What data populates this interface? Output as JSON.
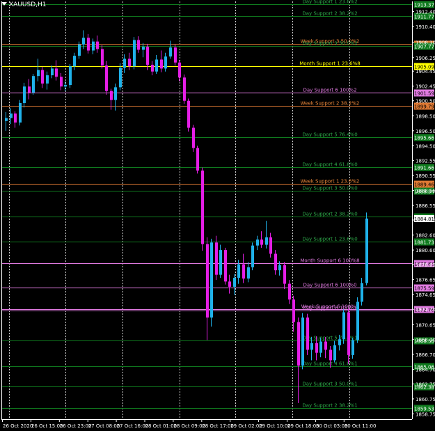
{
  "symbol": "XAUUSD,H1",
  "colors": {
    "background": "#000000",
    "grid": "#ffffff",
    "axis": "#ffffff",
    "text": "#ffffff",
    "bull_candle": "#1fb2ea",
    "bear_candle": "#e51ee6",
    "day_level": "#0f7a1e",
    "day_label": "#2ea84a",
    "week_level": "#e07a34",
    "week_label": "#f08a3a",
    "month_level": "#ffff00",
    "month6_level": "#e07ae0"
  },
  "price_axis": {
    "ticks": [
      "1912.40",
      "1910.40",
      "1908.30",
      "1906.25",
      "1904.45",
      "1902.45",
      "1900.50",
      "1898.50",
      "1896.50",
      "1894.50",
      "1892.55",
      "1890.55",
      "1888.55",
      "1886.55",
      "1884.60",
      "1882.60",
      "1880.60",
      "1878.65",
      "1876.65",
      "1874.65",
      "1872.70",
      "1870.65",
      "1868.70",
      "1866.70",
      "1864.70",
      "1862.75",
      "1860.75",
      "1858.75"
    ]
  },
  "time_axis": {
    "labels": [
      "26 Oct 2020",
      "26 Oct 15:00",
      "26 Oct 23:00",
      "27 Oct 08:00",
      "27 Oct 16:00",
      "28 Oct 01:00",
      "28 Oct 09:00",
      "28 Oct 17:00",
      "29 Oct 02:00",
      "29 Oct 10:00",
      "29 Oct 18:00",
      "30 Oct 03:00",
      "30 Oct 11:00"
    ]
  },
  "levels": [
    {
      "label": "Day Support 1 23.6%2",
      "price_tag": "1913.37",
      "kind": "day",
      "price": 1913.37
    },
    {
      "label": "Day Support 2 38.2%2",
      "price_tag": "1911.77",
      "kind": "day",
      "price": 1911.77
    },
    {
      "label": "Week Support 3 50.0%2",
      "price_tag": "1908.13",
      "kind": "week",
      "price": 1908.13
    },
    {
      "label": "Day Support 3 50.0%2",
      "price_tag": "1907.77",
      "kind": "day",
      "price": 1907.77
    },
    {
      "label": "Month Support 1 23.6%8",
      "price_tag": "1905.09",
      "kind": "month",
      "price": 1905.09
    },
    {
      "label": "Day Support 6 100%2",
      "price_tag": "1901.59",
      "kind": "magenta",
      "price": 1901.59
    },
    {
      "label": "Week Support 2 38.2%2",
      "price_tag": "1899.79",
      "kind": "week",
      "price": 1899.79
    },
    {
      "label": "Day Support 5 76.4%0",
      "price_tag": "1895.66",
      "kind": "day",
      "price": 1895.66
    },
    {
      "label": "Day Support 4 61.8%0",
      "price_tag": "1891.66",
      "kind": "day",
      "price": 1891.66
    },
    {
      "label": "Week Support 1 23.6%2",
      "price_tag": "1889.46",
      "kind": "week",
      "price": 1889.46
    },
    {
      "label": "Day Support 3 50.0%0",
      "price_tag": "1888.54",
      "kind": "day",
      "price": 1888.54
    },
    {
      "label": "Day Support 2 38.2%0",
      "price_tag": "1885.11",
      "kind": "day",
      "price": 1885.11
    },
    {
      "label": "Day Support 1 23.6%0",
      "price_tag": "1881.73",
      "kind": "day",
      "price": 1881.73
    },
    {
      "label": "Month Support 6 100%8",
      "price_tag": "1878.83",
      "kind": "magenta",
      "price": 1878.83
    },
    {
      "label": "Day Support 6 100%0",
      "price_tag": "1875.59",
      "kind": "magenta",
      "price": 1875.59
    },
    {
      "label": "Week Support 6 100%2",
      "price_tag": "1872.76",
      "kind": "magenta",
      "price": 1872.76
    },
    {
      "label": "Day Support 6 100%1",
      "price_tag": "",
      "kind": "magenta",
      "price": 1872.5
    },
    {
      "label": "Day Support 5 76.4%1",
      "price_tag": "1868.56",
      "kind": "day",
      "price": 1868.56
    },
    {
      "label": "Day Support 4 61.8%1",
      "price_tag": "1865.06",
      "kind": "day",
      "price": 1865.06
    },
    {
      "label": "Day Support 3 50.0%1",
      "price_tag": "1862.38",
      "kind": "day",
      "price": 1862.38
    },
    {
      "label": "Day Support 2 38.2%1",
      "price_tag": "1859.53",
      "kind": "day",
      "price": 1859.53
    }
  ],
  "current_price": {
    "value": 1884.81,
    "tag": "1884.81"
  },
  "candles": [
    [
      1897.8,
      1899.0,
      1896.5,
      1898.2
    ],
    [
      1898.2,
      1899.5,
      1897.4,
      1898.8
    ],
    [
      1898.8,
      1899.1,
      1896.9,
      1897.6
    ],
    [
      1897.6,
      1900.6,
      1897.2,
      1900.2
    ],
    [
      1900.2,
      1902.9,
      1899.6,
      1902.4
    ],
    [
      1902.4,
      1903.4,
      1900.7,
      1901.6
    ],
    [
      1901.6,
      1904.1,
      1901.3,
      1903.8
    ],
    [
      1903.8,
      1906.1,
      1903.1,
      1904.6
    ],
    [
      1904.6,
      1905.0,
      1902.2,
      1902.8
    ],
    [
      1902.8,
      1904.4,
      1902.0,
      1903.9
    ],
    [
      1903.9,
      1905.2,
      1903.5,
      1904.8
    ],
    [
      1904.8,
      1905.9,
      1903.2,
      1903.7
    ],
    [
      1903.7,
      1904.2,
      1901.9,
      1902.4
    ],
    [
      1902.4,
      1903.1,
      1901.8,
      1902.6
    ],
    [
      1902.6,
      1905.4,
      1902.2,
      1905.1
    ],
    [
      1905.1,
      1906.9,
      1904.6,
      1906.5
    ],
    [
      1906.5,
      1908.4,
      1906.1,
      1908.0
    ],
    [
      1908.0,
      1909.9,
      1907.4,
      1908.9
    ],
    [
      1908.9,
      1909.4,
      1906.8,
      1907.2
    ],
    [
      1907.2,
      1908.8,
      1906.7,
      1908.4
    ],
    [
      1908.4,
      1909.2,
      1906.9,
      1907.4
    ],
    [
      1907.4,
      1907.9,
      1904.8,
      1905.2
    ],
    [
      1905.2,
      1905.8,
      1901.3,
      1901.8
    ],
    [
      1901.8,
      1902.1,
      1899.3,
      1900.6
    ],
    [
      1900.6,
      1902.8,
      1899.2,
      1902.3
    ],
    [
      1902.3,
      1905.5,
      1901.9,
      1904.9
    ],
    [
      1904.9,
      1906.7,
      1904.2,
      1906.1
    ],
    [
      1906.1,
      1906.9,
      1904.6,
      1905.1
    ],
    [
      1905.1,
      1909.0,
      1904.7,
      1908.6
    ],
    [
      1908.6,
      1909.1,
      1906.9,
      1907.3
    ],
    [
      1907.3,
      1908.2,
      1906.3,
      1907.7
    ],
    [
      1907.7,
      1908.1,
      1904.6,
      1905.3
    ],
    [
      1905.3,
      1905.8,
      1903.9,
      1904.4
    ],
    [
      1904.4,
      1906.6,
      1904.1,
      1906.0
    ],
    [
      1906.0,
      1907.2,
      1904.3,
      1904.8
    ],
    [
      1904.8,
      1906.9,
      1904.4,
      1906.4
    ],
    [
      1906.4,
      1908.5,
      1906.1,
      1907.6
    ],
    [
      1907.6,
      1908.0,
      1905.2,
      1905.6
    ],
    [
      1905.6,
      1905.9,
      1903.1,
      1903.6
    ],
    [
      1903.6,
      1904.0,
      1900.1,
      1900.5
    ],
    [
      1900.5,
      1900.8,
      1896.4,
      1896.9
    ],
    [
      1896.9,
      1897.3,
      1893.7,
      1894.2
    ],
    [
      1894.2,
      1894.5,
      1890.8,
      1891.2
    ],
    [
      1891.2,
      1891.6,
      1880.5,
      1881.4
    ],
    [
      1881.4,
      1882.3,
      1868.6,
      1871.6
    ],
    [
      1871.6,
      1882.1,
      1870.4,
      1881.6
    ],
    [
      1881.6,
      1882.5,
      1876.6,
      1877.3
    ],
    [
      1877.3,
      1881.3,
      1876.9,
      1880.6
    ],
    [
      1880.6,
      1880.9,
      1876.0,
      1876.4
    ],
    [
      1876.4,
      1877.3,
      1874.8,
      1875.7
    ],
    [
      1875.7,
      1877.4,
      1874.6,
      1876.9
    ],
    [
      1876.9,
      1879.3,
      1876.1,
      1878.7
    ],
    [
      1878.7,
      1880.1,
      1876.2,
      1876.8
    ],
    [
      1876.8,
      1879.0,
      1876.3,
      1878.3
    ],
    [
      1878.3,
      1881.6,
      1877.9,
      1881.2
    ],
    [
      1881.2,
      1882.5,
      1880.6,
      1882.0
    ],
    [
      1882.0,
      1883.1,
      1880.9,
      1881.3
    ],
    [
      1881.3,
      1884.5,
      1880.8,
      1882.3
    ],
    [
      1882.3,
      1882.9,
      1879.6,
      1880.1
    ],
    [
      1880.1,
      1880.6,
      1877.3,
      1877.9
    ],
    [
      1877.9,
      1879.1,
      1877.2,
      1878.6
    ],
    [
      1878.6,
      1879.0,
      1875.4,
      1876.1
    ],
    [
      1876.1,
      1876.6,
      1873.4,
      1874.0
    ],
    [
      1874.0,
      1874.5,
      1869.7,
      1871.0
    ],
    [
      1871.0,
      1871.6,
      1860.2,
      1865.2
    ],
    [
      1865.2,
      1872.2,
      1864.7,
      1871.6
    ],
    [
      1871.6,
      1872.1,
      1866.6,
      1867.3
    ],
    [
      1867.3,
      1869.0,
      1865.9,
      1868.2
    ],
    [
      1868.2,
      1869.1,
      1865.9,
      1866.9
    ],
    [
      1866.9,
      1868.9,
      1866.3,
      1868.4
    ],
    [
      1868.4,
      1869.0,
      1866.2,
      1867.3
    ],
    [
      1867.3,
      1867.8,
      1864.9,
      1865.9
    ],
    [
      1865.9,
      1868.5,
      1865.6,
      1867.9
    ],
    [
      1867.9,
      1869.3,
      1867.2,
      1868.7
    ],
    [
      1868.7,
      1872.7,
      1868.1,
      1872.3
    ],
    [
      1872.3,
      1872.8,
      1865.4,
      1866.6
    ],
    [
      1866.6,
      1868.9,
      1866.1,
      1868.6
    ],
    [
      1868.6,
      1874.3,
      1868.2,
      1873.7
    ],
    [
      1873.7,
      1876.9,
      1873.2,
      1876.2
    ],
    [
      1876.2,
      1885.6,
      1875.9,
      1884.8
    ]
  ]
}
